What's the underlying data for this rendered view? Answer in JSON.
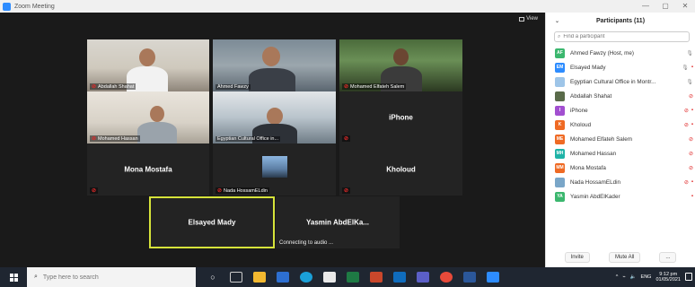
{
  "window": {
    "title": "Zoom Meeting",
    "controls": [
      "—",
      "▢",
      "✕"
    ]
  },
  "stage": {
    "view_label": "View",
    "tiles": [
      {
        "name": "Abdallah Shahat",
        "muted": true
      },
      {
        "name": "Ahmed Fawzy",
        "muted": false
      },
      {
        "name": "Mohamed Elfateh Salem",
        "muted": true
      },
      {
        "name": "Mohamed Hassan",
        "muted": true
      },
      {
        "name": "Egyptian Cultural Office in...",
        "muted": false
      },
      {
        "name": "iPhone",
        "muted": true
      },
      {
        "name": "Mona Mostafa",
        "muted": true
      },
      {
        "name": "Nada HossamELdin",
        "muted": true
      },
      {
        "name": "Kholoud",
        "muted": true
      },
      {
        "name": "Elsayed Mady",
        "muted": false
      },
      {
        "name": "Yasmin AbdElKa...",
        "muted": false,
        "status": "Connecting to audio ..."
      }
    ]
  },
  "participants": {
    "title": "Participants (11)",
    "search_placeholder": "Find a participant",
    "list": [
      {
        "initials": "AF",
        "name": "Ahmed Fawzy (Host, me)",
        "color": "#3bb76e"
      },
      {
        "initials": "EM",
        "name": "Elsayed Mady",
        "color": "#2d8cff"
      },
      {
        "initials": "",
        "name": "Egyptian Cultural Office in Montr...",
        "color": "#9ec5e8"
      },
      {
        "initials": "",
        "name": "Abdallah Shahat",
        "color": "#5a6b4a"
      },
      {
        "initials": "I",
        "name": "iPhone",
        "color": "#a24fd0"
      },
      {
        "initials": "K",
        "name": "Kholoud",
        "color": "#ef6a24"
      },
      {
        "initials": "ME",
        "name": "Mohamed Elfateh Salem",
        "color": "#ef6a24"
      },
      {
        "initials": "MH",
        "name": "Mohamed Hassan",
        "color": "#1fb3a7"
      },
      {
        "initials": "MM",
        "name": "Mona Mostafa",
        "color": "#ef6a24"
      },
      {
        "initials": "",
        "name": "Nada HossamELdin",
        "color": "#7aa6c8"
      },
      {
        "initials": "YA",
        "name": "Yasmin AbdElKader",
        "color": "#3bb76e"
      }
    ],
    "invite_label": "Invite",
    "mute_all_label": "Mute All",
    "more_label": "..."
  },
  "taskbar": {
    "search_placeholder": "Type here to search",
    "tray_lang": "ENG",
    "time": "9:12 pm",
    "date": "01/05/2021"
  }
}
